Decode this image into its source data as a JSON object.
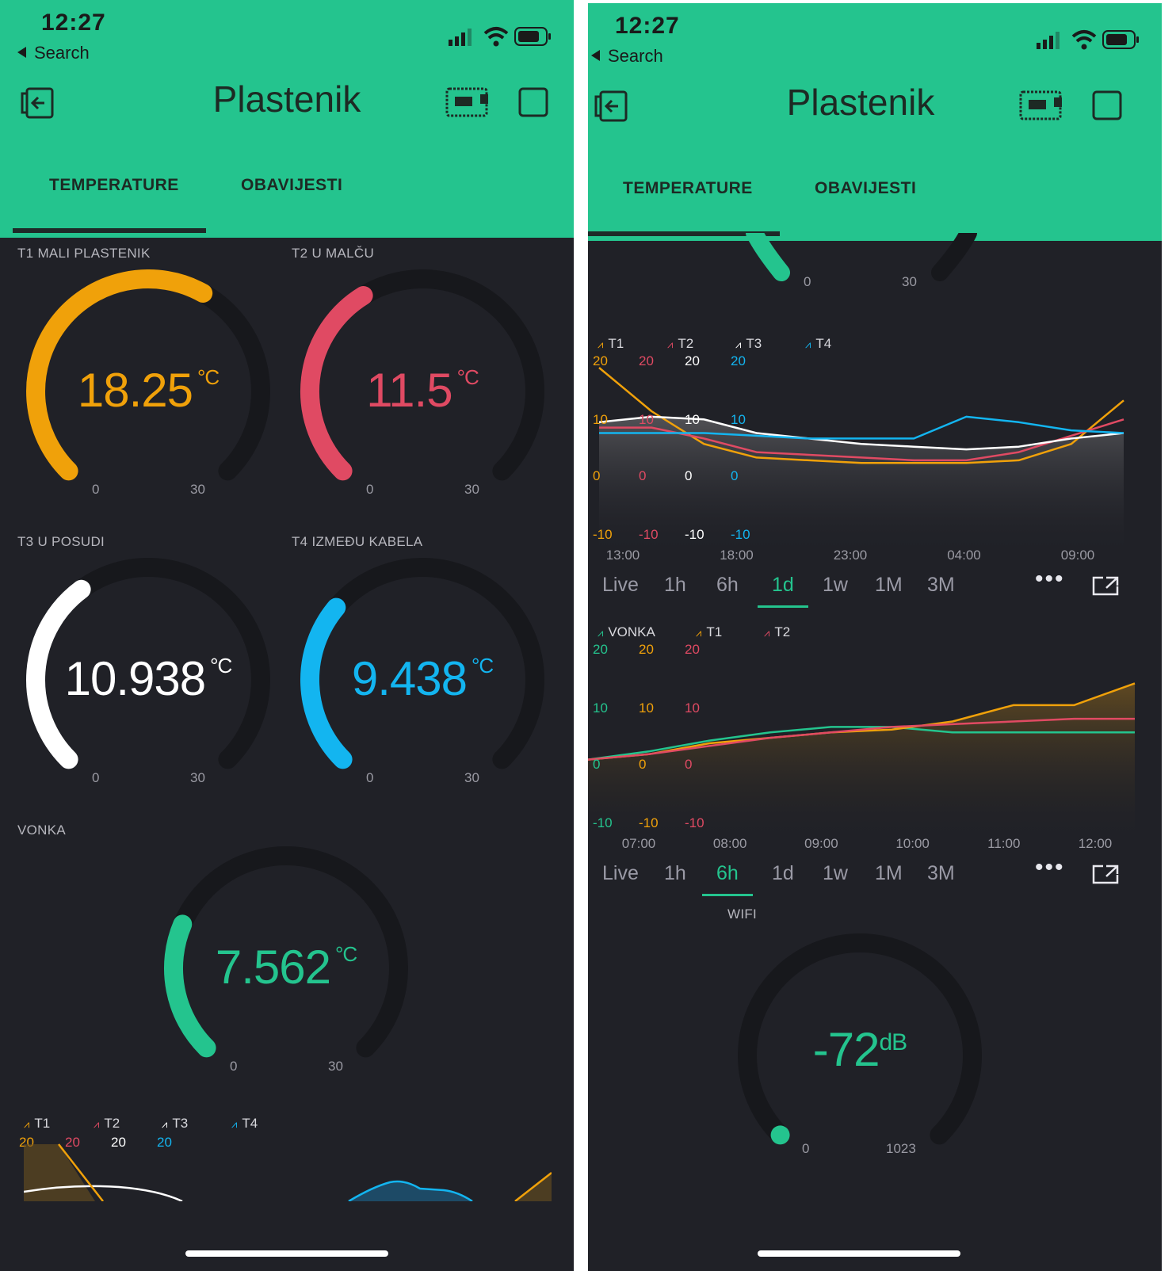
{
  "colors": {
    "accent": "#24c48e",
    "background": "#202127",
    "gauge_track": "#17181c",
    "t1": "#f0a10a",
    "t2": "#e04a63",
    "t3": "#ffffff",
    "t4": "#13b5f0",
    "vonka": "#24c48e"
  },
  "status_bar": {
    "time": "12:27",
    "back_label": "Search"
  },
  "header": {
    "title": "Plastenik",
    "icons": [
      "back-device-icon",
      "device-board-icon",
      "square-icon"
    ]
  },
  "tabs": [
    {
      "label": "TEMPERATURE",
      "active": true
    },
    {
      "label": "OBAVIJESTI",
      "active": false
    }
  ],
  "gauges": [
    {
      "label": "T1 MALI PLASTENIK",
      "value": "18.25",
      "unit": "°C",
      "min": "0",
      "max": "30",
      "color": "#f0a10a"
    },
    {
      "label": "T2 U MALČU",
      "value": "11.5",
      "unit": "°C",
      "min": "0",
      "max": "30",
      "color": "#e04a63"
    },
    {
      "label": "T3 U POSUDI",
      "value": "10.938",
      "unit": "°C",
      "min": "0",
      "max": "30",
      "color": "#ffffff"
    },
    {
      "label": "T4 IZMEĐU KABELA",
      "value": "9.438",
      "unit": "°C",
      "min": "0",
      "max": "30",
      "color": "#13b5f0"
    },
    {
      "label": "VONKA",
      "value": "7.562",
      "unit": "°C",
      "min": "0",
      "max": "30",
      "color": "#24c48e"
    }
  ],
  "partial_gauge": {
    "min": "0",
    "max": "30"
  },
  "wifi_gauge": {
    "label": "WIFI",
    "value": "-72",
    "unit": "dB",
    "min": "0",
    "max": "1023",
    "color": "#24c48e"
  },
  "time_ranges": [
    "Live",
    "1h",
    "6h",
    "1d",
    "1w",
    "1M",
    "3M"
  ],
  "chart_data": [
    {
      "type": "line",
      "selected_range": "1d",
      "x_tick_labels": [
        "13:00",
        "18:00",
        "23:00",
        "04:00",
        "09:00"
      ],
      "y_tick_labels": [
        "20",
        "10",
        "0",
        "-10"
      ],
      "series": [
        {
          "name": "T1",
          "color": "#f0a10a",
          "values": [
            22,
            14,
            8,
            5.5,
            5,
            4.5,
            4.5,
            4.5,
            5,
            8,
            16
          ]
        },
        {
          "name": "T2",
          "color": "#e04a63",
          "values": [
            11,
            11,
            9,
            6.5,
            6,
            5.5,
            5,
            5,
            6.5,
            9.5,
            12.5
          ]
        },
        {
          "name": "T3",
          "color": "#ffffff",
          "values": [
            12,
            13,
            12.5,
            10,
            9,
            8,
            7.5,
            7,
            7.5,
            9,
            10
          ]
        },
        {
          "name": "T4",
          "color": "#13b5f0",
          "values": [
            10,
            10,
            10,
            9.5,
            9,
            9,
            9,
            13,
            12,
            10.5,
            10
          ]
        }
      ]
    },
    {
      "type": "line",
      "selected_range": "6h",
      "x_tick_labels": [
        "07:00",
        "08:00",
        "09:00",
        "10:00",
        "11:00",
        "12:00"
      ],
      "y_tick_labels": [
        "20",
        "10",
        "0",
        "-10"
      ],
      "series": [
        {
          "name": "VONKA",
          "color": "#24c48e",
          "values": [
            3,
            4.5,
            6.5,
            8,
            9,
            9,
            8,
            8,
            8,
            8
          ]
        },
        {
          "name": "T1",
          "color": "#f0a10a",
          "values": [
            3,
            4,
            6,
            7,
            8,
            8.5,
            10,
            13,
            13,
            17
          ]
        },
        {
          "name": "T2",
          "color": "#e04a63",
          "values": [
            3,
            4,
            5.5,
            7,
            8,
            9,
            9.5,
            10,
            10.5,
            10.5
          ]
        }
      ]
    }
  ]
}
